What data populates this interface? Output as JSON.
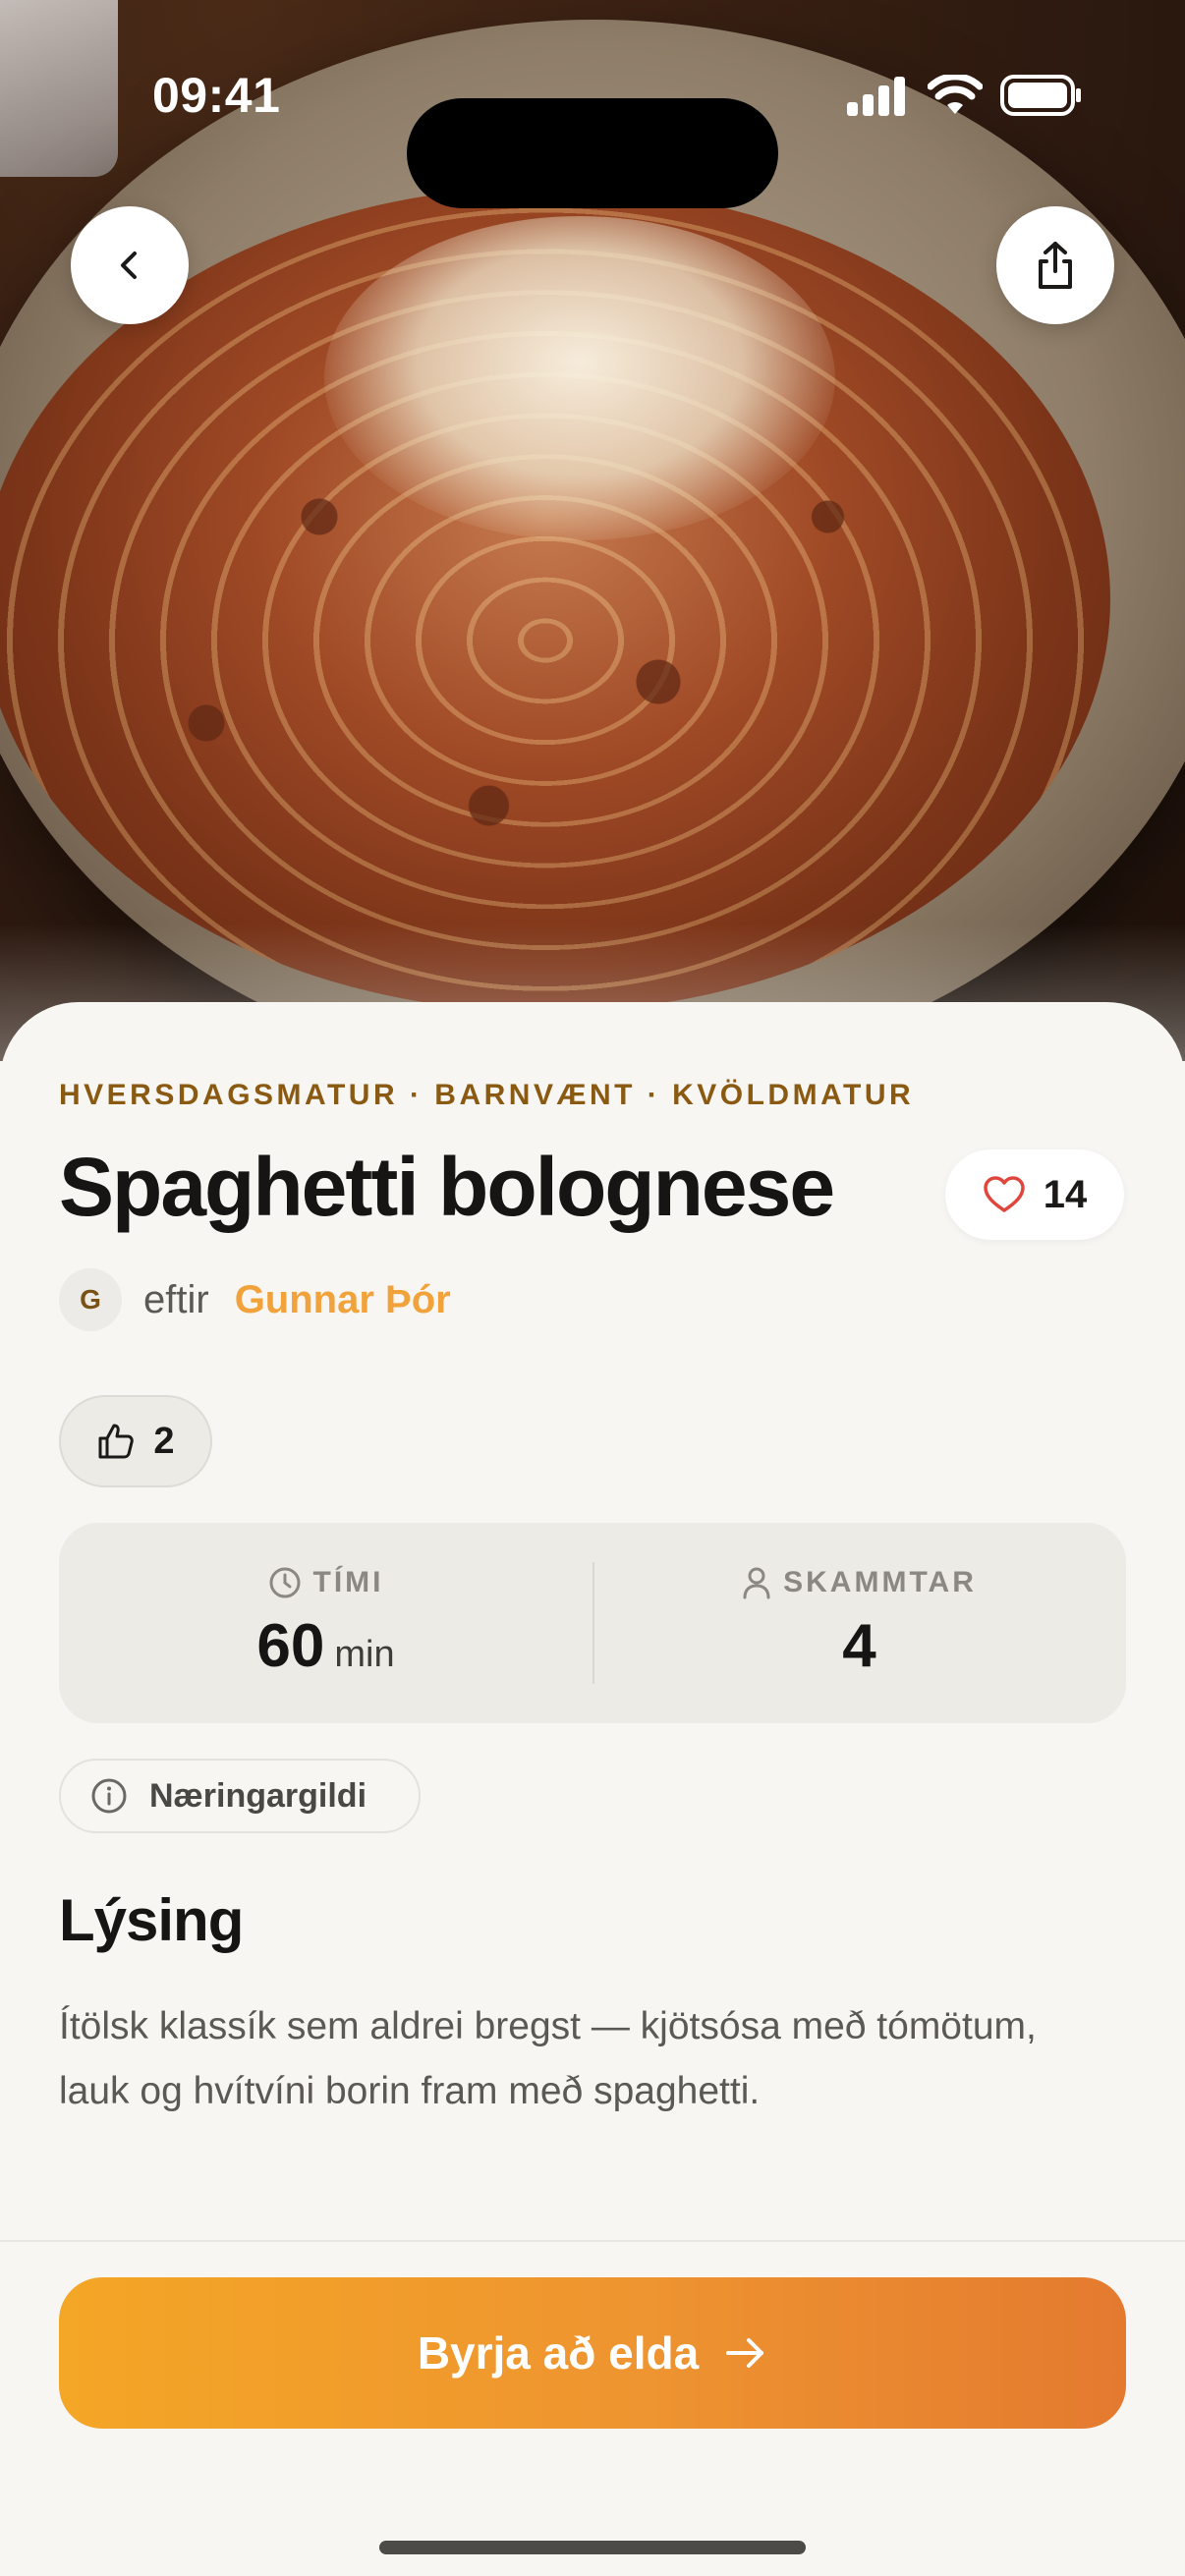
{
  "status_bar": {
    "time": "09:41"
  },
  "recipe": {
    "tags": "HVERSDAGSMATUR · BARNVÆNT · KVÖLDMATUR",
    "title": "Spaghetti bolognese",
    "likes_count": "14",
    "author": {
      "initial": "G",
      "by_label": "eftir",
      "name": "Gunnar Þór"
    },
    "upvotes": "2",
    "stats": {
      "time": {
        "label": "TÍMI",
        "value": "60",
        "unit": "min"
      },
      "servings": {
        "label": "SKAMMTAR",
        "value": "4"
      }
    },
    "nutrition_label": "Næringargildi",
    "description_heading": "Lýsing",
    "description": "Ítölsk klassík sem aldrei bregst — kjötsósa með tómötum, lauk og hvítvíni borin fram með spaghetti."
  },
  "cta": {
    "label": "Byrja að elda"
  },
  "colors": {
    "accent": "#f2a23a",
    "tag": "#8a5a12",
    "heart": "#e0463e"
  },
  "icons": [
    "back-chevron-icon",
    "share-icon",
    "heart-icon",
    "thumbs-up-icon",
    "clock-icon",
    "person-icon",
    "info-icon",
    "arrow-right-icon"
  ]
}
